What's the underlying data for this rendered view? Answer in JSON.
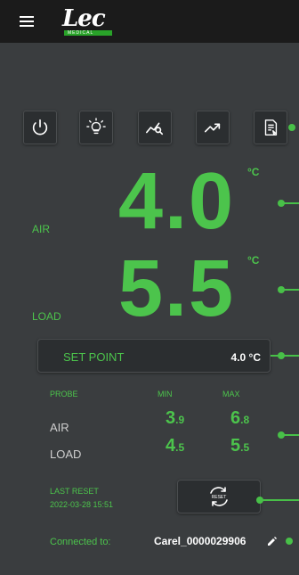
{
  "header": {
    "logo_text": "Lec",
    "logo_subtext": "MEDICAL"
  },
  "toolbar": {
    "buttons": [
      {
        "icon": "power-icon"
      },
      {
        "icon": "light-bulb-icon"
      },
      {
        "icon": "chart-search-icon"
      },
      {
        "icon": "trend-icon"
      },
      {
        "icon": "report-icon"
      }
    ]
  },
  "readings": {
    "air": {
      "label": "AIR",
      "value": "4.0",
      "unit": "°C"
    },
    "load": {
      "label": "LOAD",
      "value": "5.5",
      "unit": "°C"
    }
  },
  "setpoint": {
    "label": "SET POINT",
    "value": "4.0 °C"
  },
  "minmax": {
    "probe_header": "PROBE",
    "min_header": "MIN",
    "max_header": "MAX",
    "rows": [
      {
        "probe": "AIR",
        "min_int": "3",
        "min_dec": ".9",
        "max_int": "6",
        "max_dec": ".8"
      },
      {
        "probe": "LOAD",
        "min_int": "4",
        "min_dec": ".5",
        "max_int": "5",
        "max_dec": ".5"
      }
    ]
  },
  "reset": {
    "label": "LAST RESET",
    "timestamp": "2022-03-28 15:51",
    "button_text": "RESET"
  },
  "connection": {
    "label": "Connected to:",
    "device": "Carel_0000029906"
  },
  "colors": {
    "accent": "#4cc44c",
    "background": "#3a3d3f",
    "topbar": "#1b1b1b",
    "button_bg": "#2b2e30"
  }
}
